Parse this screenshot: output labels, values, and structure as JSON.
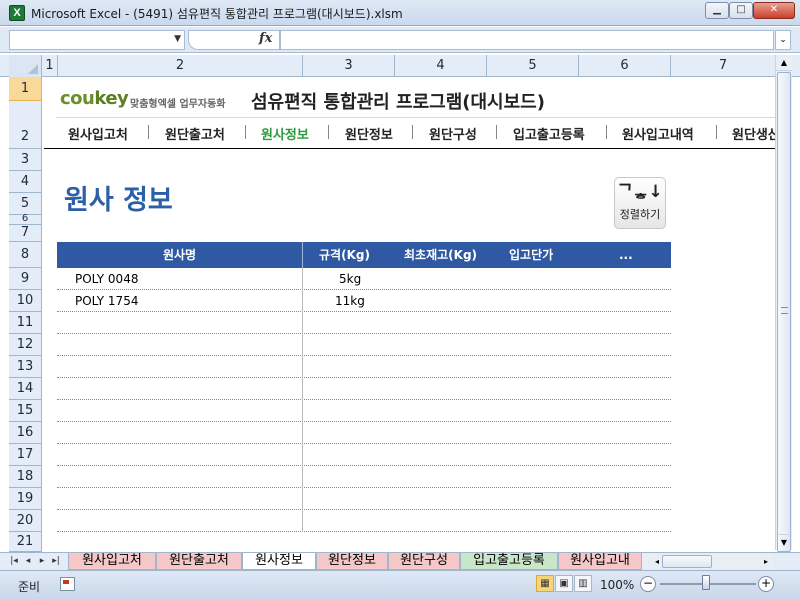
{
  "window": {
    "app_icon": "X",
    "title": "Microsoft Excel - (5491) 섬유편직 통합관리 프로그램(대시보드).xlsm"
  },
  "formula_bar": {
    "name_box_value": "",
    "formula_value": "",
    "fx_label": "fx"
  },
  "columns": [
    "1",
    "2",
    "3",
    "4",
    "5",
    "6",
    "7"
  ],
  "rows": [
    "1",
    "2",
    "3",
    "4",
    "5",
    "6",
    "7",
    "8",
    "9",
    "10",
    "11",
    "12",
    "13",
    "14",
    "15",
    "16",
    "17",
    "18",
    "19",
    "20",
    "21"
  ],
  "brand": {
    "logo_part1": "cou",
    "logo_part2": "key",
    "subtitle": "맞춤형엑셀 업무자동화",
    "app_title": "섬유편직 통합관리 프로그램(대시보드)"
  },
  "nav": {
    "active_index": 2,
    "items": [
      "원사입고처",
      "원단출고처",
      "원사정보",
      "원단정보",
      "원단구성",
      "입고출고등록",
      "원사입고내역",
      "원단생산"
    ]
  },
  "section_title": "원사 정보",
  "sort_button": {
    "icon_glyph": "ᄀᇂ↓",
    "label": "정렬하기"
  },
  "table": {
    "headers": [
      "원사명",
      "규격(Kg)",
      "최초재고(Kg)",
      "입고단가",
      "..."
    ],
    "rows": [
      {
        "name": "POLY 0048",
        "spec": "5kg"
      },
      {
        "name": "POLY 1754",
        "spec": "11kg"
      }
    ]
  },
  "sheet_tabs": {
    "active_index": 2,
    "items": [
      "원사입고처",
      "원단출고처",
      "원사정보",
      "원단정보",
      "원단구성",
      "입고출고등록",
      "원사입고내"
    ]
  },
  "status": {
    "ready": "준비",
    "zoom": "100%"
  }
}
